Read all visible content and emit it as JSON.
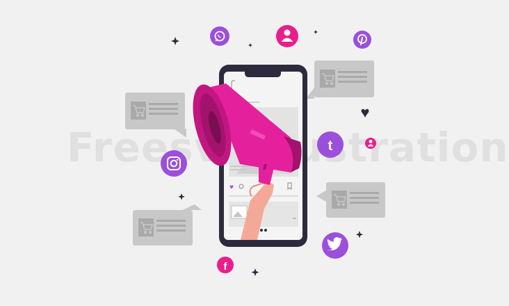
{
  "illustration": {
    "watermark_text": "Freesvgillustration",
    "colors": {
      "background": "#f1f1f1",
      "bubble": "#c8c8c8",
      "bubble_inner": "#a9a9a9",
      "phone_body": "#2d2a3e",
      "phone_screen": "#f4f4f4",
      "megaphone": "#e5209c",
      "megaphone_dark": "#a3136d",
      "hand_skin": "#f4a998",
      "social_purple": "#9b4fdb",
      "social_pink": "#e91e8c",
      "heart": "#2d2a3e",
      "sparkle": "#2d2a3e"
    },
    "social_icons": [
      {
        "name": "whatsapp-icon"
      },
      {
        "name": "user-icon"
      },
      {
        "name": "pinterest-icon"
      },
      {
        "name": "tumblr-icon"
      },
      {
        "name": "instagram-icon"
      },
      {
        "name": "twitter-icon"
      },
      {
        "name": "facebook-icon"
      },
      {
        "name": "small-user-icon"
      }
    ],
    "tumblr_glyph": "t",
    "facebook_glyph": "f",
    "pinterest_glyph": "P",
    "heart_glyph": "♥"
  }
}
